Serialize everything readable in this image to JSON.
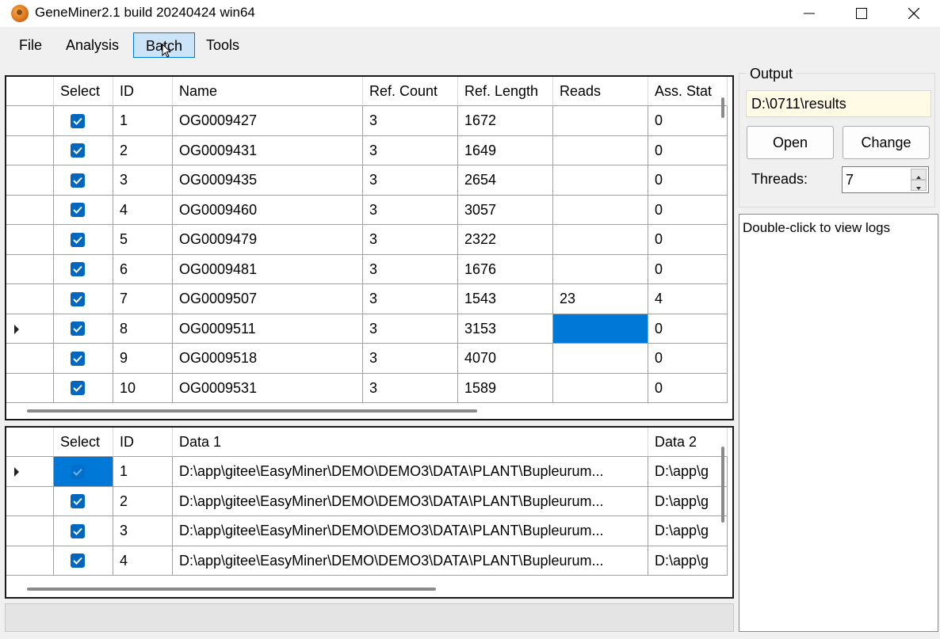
{
  "window": {
    "title": "GeneMiner2.1 build 20240424 win64"
  },
  "menu": [
    {
      "label": "File",
      "active": false
    },
    {
      "label": "Analysis",
      "active": false
    },
    {
      "label": "Batch",
      "active": true
    },
    {
      "label": "Tools",
      "active": false
    }
  ],
  "gene_table": {
    "columns": [
      "Select",
      "ID",
      "Name",
      "Ref. Count",
      "Ref. Length",
      "Reads",
      "Ass. Stat"
    ],
    "rows": [
      {
        "checked": true,
        "id": "1",
        "name": "OG0009427",
        "ref_count": "3",
        "ref_length": "1672",
        "reads": "",
        "ass_stat": "0"
      },
      {
        "checked": true,
        "id": "2",
        "name": "OG0009431",
        "ref_count": "3",
        "ref_length": "1649",
        "reads": "",
        "ass_stat": "0"
      },
      {
        "checked": true,
        "id": "3",
        "name": "OG0009435",
        "ref_count": "3",
        "ref_length": "2654",
        "reads": "",
        "ass_stat": "0"
      },
      {
        "checked": true,
        "id": "4",
        "name": "OG0009460",
        "ref_count": "3",
        "ref_length": "3057",
        "reads": "",
        "ass_stat": "0"
      },
      {
        "checked": true,
        "id": "5",
        "name": "OG0009479",
        "ref_count": "3",
        "ref_length": "2322",
        "reads": "",
        "ass_stat": "0"
      },
      {
        "checked": true,
        "id": "6",
        "name": "OG0009481",
        "ref_count": "3",
        "ref_length": "1676",
        "reads": "",
        "ass_stat": "0"
      },
      {
        "checked": true,
        "id": "7",
        "name": "OG0009507",
        "ref_count": "3",
        "ref_length": "1543",
        "reads": "23",
        "ass_stat": "4"
      },
      {
        "checked": true,
        "id": "8",
        "name": "OG0009511",
        "ref_count": "3",
        "ref_length": "3153",
        "reads": "",
        "ass_stat": "0",
        "current": true,
        "selected_cell": "reads"
      },
      {
        "checked": true,
        "id": "9",
        "name": "OG0009518",
        "ref_count": "3",
        "ref_length": "4070",
        "reads": "",
        "ass_stat": "0"
      },
      {
        "checked": true,
        "id": "10",
        "name": "OG0009531",
        "ref_count": "3",
        "ref_length": "1589",
        "reads": "",
        "ass_stat": "0"
      }
    ]
  },
  "data_table": {
    "columns": [
      "Select",
      "ID",
      "Data 1",
      "Data 2"
    ],
    "rows": [
      {
        "checked": true,
        "id": "1",
        "data1": "D:\\app\\gitee\\EasyMiner\\DEMO\\DEMO3\\DATA\\PLANT\\Bupleurum...",
        "data2": "D:\\app\\g",
        "current": true,
        "selected_cell": "select"
      },
      {
        "checked": true,
        "id": "2",
        "data1": "D:\\app\\gitee\\EasyMiner\\DEMO\\DEMO3\\DATA\\PLANT\\Bupleurum...",
        "data2": "D:\\app\\g"
      },
      {
        "checked": true,
        "id": "3",
        "data1": "D:\\app\\gitee\\EasyMiner\\DEMO\\DEMO3\\DATA\\PLANT\\Bupleurum...",
        "data2": "D:\\app\\g"
      },
      {
        "checked": true,
        "id": "4",
        "data1": "D:\\app\\gitee\\EasyMiner\\DEMO\\DEMO3\\DATA\\PLANT\\Bupleurum...",
        "data2": "D:\\app\\g"
      }
    ]
  },
  "output": {
    "group_title": "Output",
    "path": "D:\\0711\\results",
    "open_label": "Open",
    "change_label": "Change",
    "threads_label": "Threads:",
    "threads_value": "7"
  },
  "log": {
    "hint": "Double-click to view logs"
  },
  "colors": {
    "accent": "#0078d7",
    "checkbox": "#0067c0",
    "selection": "#0078d7",
    "path_bg": "#fffbe5"
  }
}
